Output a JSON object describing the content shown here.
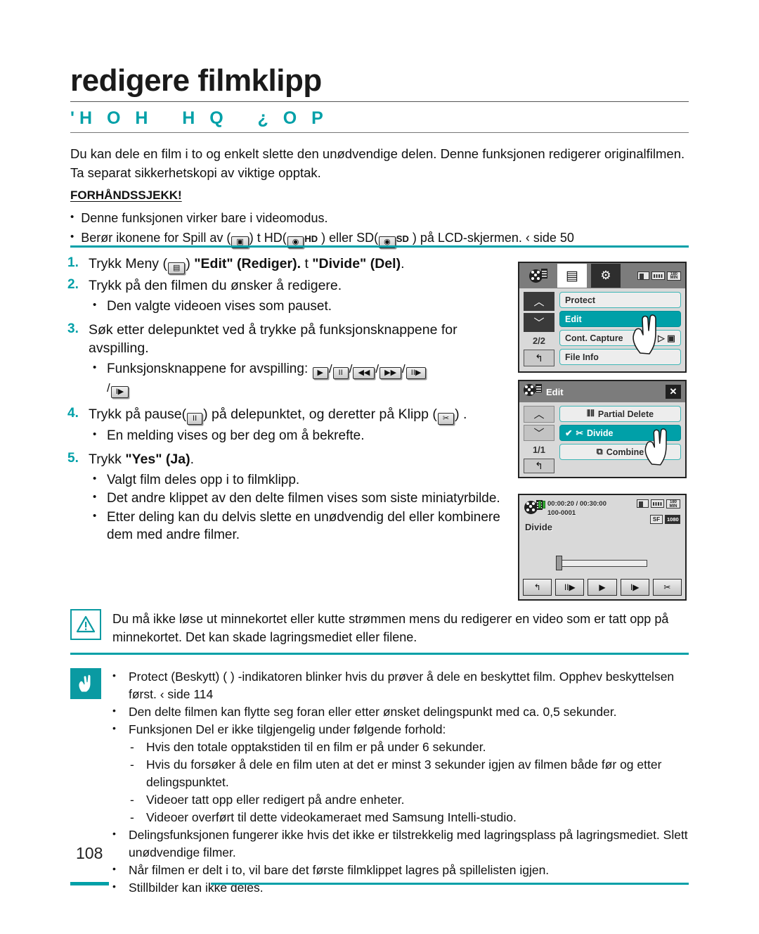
{
  "header": {
    "title": "redigere filmklipp",
    "subtitle": "'H O H   H Q   ¿ O P"
  },
  "intro": {
    "paragraph": "Du kan dele en film i to og enkelt slette den unødvendige delen. Denne funksjonen redigerer originalfilmen. Ta separat sikkerhetskopi av viktige opptak.",
    "precheck_title": "FORHÅNDSSJEKK!",
    "precheck_items": [
      "Denne funksjonen virker bare i videomodus.",
      "Berør ikonene for Spill av ( ) t  HD( HD ) eller SD( SD ) på LCD-skjermen.  ‹ side 50"
    ],
    "precheck2_pre": "Berør ikonene for Spill av (",
    "precheck2_mid1": ") t  HD(",
    "precheck2_hd": "HD",
    "precheck2_mid2": " ) eller SD(",
    "precheck2_sd": "SD",
    "precheck2_end": " ) på LCD-skjermen.  ‹ side 50"
  },
  "steps": [
    {
      "num": "1.",
      "pre": "Trykk Meny (",
      "post_a": ") ",
      "bold_a": "\"Edit\" (Rediger).",
      "mid": " t  ",
      "bold_b": "\"Divide\" (Del)",
      "tail": ".",
      "subs": []
    },
    {
      "num": "2.",
      "text": "Trykk på den filmen du ønsker å redigere.",
      "subs": [
        "Den valgte videoen vises som pauset."
      ]
    },
    {
      "num": "3.",
      "text": "Søk etter delepunktet ved å trykke på funksjonsknappene for avspilling.",
      "sub_label": "Funksjonsknappene for avspilling:",
      "subs": []
    },
    {
      "num": "4.",
      "pre": "Trykk på pause(",
      "mid": ") på delepunktet, og deretter på Klipp (",
      "tail": ") .",
      "subs": [
        "En melding vises og ber deg om å bekrefte."
      ]
    },
    {
      "num": "5.",
      "pre": "Trykk ",
      "bold_a": "\"Yes\" (Ja)",
      "tail": ".",
      "subs": [
        "Valgt film deles opp i to filmklipp.",
        "Det andre klippet av den delte filmen vises som siste miniatyrbilde.",
        "Etter deling kan du delvis slette en unødvendig del eller kombinere dem med andre filmer."
      ]
    }
  ],
  "playback_keys": [
    "▶",
    "II",
    "◀◀",
    "▶▶",
    "II▶",
    "I▶"
  ],
  "lcd1": {
    "page_indicator": "2/2",
    "back_icon": "↰",
    "up_icon": "︿",
    "down_icon": "﹀",
    "status": {
      "card": "card-icon",
      "battery": "battery-icon",
      "minutes": "180 MIN"
    },
    "items": [
      {
        "label": "Protect",
        "selected": false
      },
      {
        "label": "Edit",
        "selected": true
      },
      {
        "label": "Cont. Capture",
        "selected": false,
        "right": "▷  ▣"
      },
      {
        "label": "File Info",
        "selected": false
      }
    ]
  },
  "lcd2": {
    "title": "Edit",
    "close_icon": "✕",
    "page_indicator": "1/1",
    "back_icon": "↰",
    "items": [
      {
        "label": "Partial Delete",
        "selected": false,
        "glyph": "⦀⦀"
      },
      {
        "label": "Divide",
        "selected": true,
        "glyph": "✂",
        "check": "✔"
      },
      {
        "label": "Combine",
        "selected": false,
        "glyph": "⧉"
      }
    ]
  },
  "lcd3": {
    "label": "Divide",
    "timecode": "00:00:20 / 00:30:00",
    "fileno": "100-0001",
    "status_row1": {
      "card": "card-icon",
      "battery": "battery-icon",
      "minutes": "180 MIN"
    },
    "status_row2": {
      "quality": "SF",
      "resolution": "1080"
    },
    "buttons": [
      "↰",
      "II▶",
      "▶",
      "I▶",
      "✂"
    ]
  },
  "caution": {
    "text": "Du må ikke løse ut minnekortet eller kutte strømmen mens du redigerer en video som er tatt opp på minnekortet. Det kan skade lagringsmediet eller filene."
  },
  "notes": [
    {
      "type": "bullet",
      "text": "Protect (Beskytt) (  ) -indikatoren blinker hvis du prøver å dele en beskyttet film. Opphev beskyttelsen først.  ‹ side 114"
    },
    {
      "type": "bullet",
      "text": "Den delte filmen kan flytte seg foran eller etter ønsket delingspunkt med ca. 0,5 sekunder."
    },
    {
      "type": "bullet",
      "text": "Funksjonen Del er ikke tilgjengelig under følgende forhold:"
    },
    {
      "type": "dash",
      "text": "Hvis den totale opptakstiden til en film er på under 6 sekunder."
    },
    {
      "type": "dash",
      "text": "Hvis du forsøker å dele en film uten at det er minst 3 sekunder igjen av filmen både før og etter delingspunktet."
    },
    {
      "type": "dash",
      "text": "Videoer tatt opp eller redigert på andre enheter."
    },
    {
      "type": "dash",
      "text": "Videoer overført til dette videokameraet med Samsung Intelli-studio."
    },
    {
      "type": "bullet",
      "text": "Delingsfunksjonen fungerer ikke hvis det ikke er tilstrekkelig med lagringsplass på lagringsmediet. Slett unødvendige filmer."
    },
    {
      "type": "bullet",
      "text": "Når filmen er delt i to, vil bare det første filmklippet lagres på spillelisten igjen."
    },
    {
      "type": "bullet",
      "text": "Stillbilder kan ikke deles."
    }
  ],
  "footer": {
    "page_number": "108"
  },
  "colors": {
    "accent": "#00a0a8",
    "text": "#111111",
    "lcd_bg": "#d9d9d9"
  }
}
